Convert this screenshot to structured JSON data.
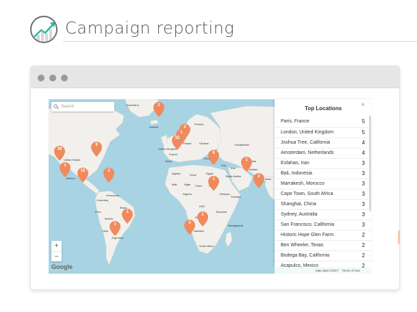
{
  "header": {
    "title": "Campaign reporting",
    "logo_icon": "trend-up-chart-icon",
    "accent_color": "#2bb7a6"
  },
  "browser": {
    "dot_color": "#9a9a9a"
  },
  "map": {
    "search_placeholder": "Search",
    "zoom_in": "+",
    "zoom_out": "−",
    "provider": "Google",
    "attribution": "Map data ©2017",
    "terms": "Terms of Use",
    "pin_color": "#f08a5d",
    "water_color": "#a8d3e3",
    "land_color": "#f2f0ec",
    "labels": {
      "greenland": "Greenland",
      "iceland": "Iceland",
      "finland": "Finland",
      "united_states": "United States",
      "mexico": "Mexico",
      "venezuela": "Venezuela",
      "colombia": "Colombia",
      "peru": "Peru",
      "brazil": "Brazil",
      "bolivia": "Bolivia",
      "chile": "Chile",
      "argentina": "Argentina",
      "uk": "United Kingdom",
      "france": "France",
      "poland": "Poland",
      "ukraine": "Ukraine",
      "spain": "Spain",
      "turkey": "Turkey",
      "kazakhstan": "Kazakhstan",
      "iraq": "Iraq",
      "iran": "Iran",
      "afghanistan": "Afghanistan",
      "pakistan": "Pakistan",
      "india": "India",
      "saudi": "Saudi Arabia",
      "algeria": "Algeria",
      "libya": "Libya",
      "egypt": "Egypt",
      "mali": "Mali",
      "niger": "Niger",
      "chad": "Chad",
      "sudan": "Sudan",
      "ethiopia": "Ethiopia",
      "nigeria": "Nigeria",
      "drc": "DRC",
      "tanzania": "Tanzania",
      "angola": "Angola",
      "namibia": "Namibia",
      "madagascar": "Madagascar",
      "south_africa": "South Africa",
      "somalia": "Somalia"
    },
    "pins": [
      {
        "label": "1"
      },
      {
        "label": "2"
      },
      {
        "label": "1"
      },
      {
        "label": "32"
      },
      {
        "label": "38"
      },
      {
        "label": "9"
      },
      {
        "label": "1"
      },
      {
        "label": "15"
      },
      {
        "label": "2"
      },
      {
        "label": "9"
      },
      {
        "label": "1"
      },
      {
        "label": "1"
      },
      {
        "label": "2"
      },
      {
        "label": "1"
      },
      {
        "label": "1"
      },
      {
        "label": "1"
      },
      {
        "label": "3"
      }
    ]
  },
  "panel": {
    "title": "Top Locations",
    "close": "×",
    "locations": [
      {
        "name": "Paris, France",
        "count": "5"
      },
      {
        "name": "London, United Kingdom",
        "count": "5"
      },
      {
        "name": "Joshua Tree, California",
        "count": "4"
      },
      {
        "name": "Amsterdam, Netherlands",
        "count": "4"
      },
      {
        "name": "Esfahan, Iran",
        "count": "3"
      },
      {
        "name": "Bali, Indonesia",
        "count": "3"
      },
      {
        "name": "Marrakesh, Morocco",
        "count": "3"
      },
      {
        "name": "Cape Town, South Africa",
        "count": "3"
      },
      {
        "name": "Shanghai, China",
        "count": "3"
      },
      {
        "name": "Sydney, Australia",
        "count": "3"
      },
      {
        "name": "San Francisco, California",
        "count": "3"
      },
      {
        "name": "Historic Hope Glen Farm",
        "count": "2"
      },
      {
        "name": "Ben Wheeler, Texas",
        "count": "2"
      },
      {
        "name": "Bodega Bay, California",
        "count": "2"
      },
      {
        "name": "Acapulco, Mexico",
        "count": "2"
      }
    ]
  }
}
